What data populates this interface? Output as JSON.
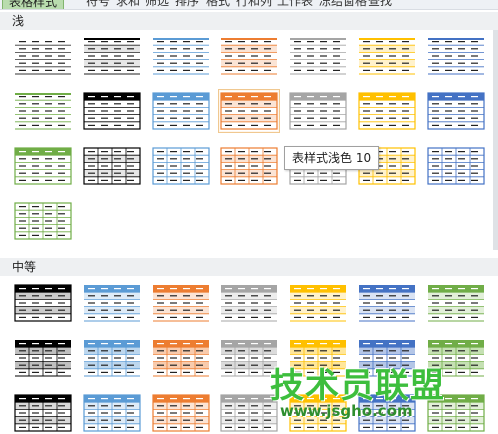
{
  "toolbar": {
    "items": [
      {
        "label": "表格样式",
        "active": true
      },
      {
        "label": "符号"
      },
      {
        "label": "求和"
      },
      {
        "label": "筛选"
      },
      {
        "label": "排序"
      },
      {
        "label": "格式"
      },
      {
        "label": "行和列"
      },
      {
        "label": "工作表"
      },
      {
        "label": "冻结窗格"
      },
      {
        "label": "查找"
      }
    ]
  },
  "sections": [
    {
      "title": "浅",
      "styles": [
        {
          "hdr": "#ffffff",
          "line": "#333333",
          "band": null,
          "border": null,
          "grid": false,
          "dark": false
        },
        {
          "hdr": "#000000",
          "line": "#222222",
          "band": "#e6e6e6",
          "border": null,
          "grid": false,
          "dark": false,
          "thinhdr": true
        },
        {
          "hdr": "#5b9bd5",
          "line": "#5b9bd5",
          "band": null,
          "border": null,
          "grid": false,
          "dark": false,
          "thinhdr": true
        },
        {
          "hdr": "#ed7d31",
          "line": "#ed7d31",
          "band": "#fbe4d5",
          "border": null,
          "grid": false,
          "dark": false,
          "thinhdr": true
        },
        {
          "hdr": "#a5a5a5",
          "line": "#a5a5a5",
          "band": null,
          "border": null,
          "grid": false,
          "dark": false,
          "thinhdr": true
        },
        {
          "hdr": "#ffc000",
          "line": "#ffc000",
          "band": "#fff2cc",
          "border": null,
          "grid": false,
          "dark": false,
          "thinhdr": true
        },
        {
          "hdr": "#4472c4",
          "line": "#4472c4",
          "band": null,
          "border": null,
          "grid": false,
          "dark": false,
          "thinhdr": true
        },
        {
          "hdr": "#70ad47",
          "line": "#70ad47",
          "band": null,
          "border": null,
          "grid": false,
          "dark": false,
          "thinhdr": true
        },
        {
          "hdr": "#000000",
          "line": "#000000",
          "band": null,
          "border": "#000000",
          "grid": false,
          "dark": true
        },
        {
          "hdr": "#5b9bd5",
          "line": "#5b9bd5",
          "band": null,
          "border": "#5b9bd5",
          "grid": false,
          "dark": true
        },
        {
          "hdr": "#ed7d31",
          "line": "#ed7d31",
          "band": "#fbe4d5",
          "border": "#ed7d31",
          "grid": false,
          "dark": true
        },
        {
          "hdr": "#a5a5a5",
          "line": "#a5a5a5",
          "band": null,
          "border": "#a5a5a5",
          "grid": false,
          "dark": true
        },
        {
          "hdr": "#ffc000",
          "line": "#ffc000",
          "band": null,
          "border": "#ffc000",
          "grid": false,
          "dark": true
        },
        {
          "hdr": "#4472c4",
          "line": "#4472c4",
          "band": null,
          "border": "#4472c4",
          "grid": false,
          "dark": true
        },
        {
          "hdr": "#70ad47",
          "line": "#70ad47",
          "band": null,
          "border": "#70ad47",
          "grid": false,
          "dark": true
        },
        {
          "hdr": "#ffffff",
          "line": "#000000",
          "band": "#e6e6e6",
          "border": "#000000",
          "grid": true,
          "dark": false
        },
        {
          "hdr": "#ffffff",
          "line": "#5b9bd5",
          "band": null,
          "border": "#5b9bd5",
          "grid": true,
          "dark": false
        },
        {
          "hdr": "#ffffff",
          "line": "#ed7d31",
          "band": "#fbe4d5",
          "border": "#ed7d31",
          "grid": true,
          "dark": false
        },
        {
          "hdr": "#ffffff",
          "line": "#a5a5a5",
          "band": null,
          "border": "#a5a5a5",
          "grid": true,
          "dark": false
        },
        {
          "hdr": "#ffffff",
          "line": "#ffc000",
          "band": "#fff2cc",
          "border": "#ffc000",
          "grid": true,
          "dark": false
        },
        {
          "hdr": "#ffffff",
          "line": "#4472c4",
          "band": null,
          "border": "#4472c4",
          "grid": true,
          "dark": false
        },
        {
          "hdr": "#ffffff",
          "line": "#70ad47",
          "band": null,
          "border": "#70ad47",
          "grid": true,
          "dark": false
        }
      ]
    },
    {
      "title": "中等",
      "styles": [
        {
          "hdr": "#000000",
          "line": "#000000",
          "band": "#cccccc",
          "border": "#000000",
          "grid": false,
          "dark": true
        },
        {
          "hdr": "#5b9bd5",
          "line": "#5b9bd5",
          "band": "#deebf7",
          "border": null,
          "grid": false,
          "dark": true
        },
        {
          "hdr": "#ed7d31",
          "line": "#ed7d31",
          "band": "#fbe4d5",
          "border": null,
          "grid": false,
          "dark": true
        },
        {
          "hdr": "#a5a5a5",
          "line": "#a5a5a5",
          "band": "#ededed",
          "border": null,
          "grid": false,
          "dark": true
        },
        {
          "hdr": "#ffc000",
          "line": "#ffc000",
          "band": "#fff2cc",
          "border": null,
          "grid": false,
          "dark": true
        },
        {
          "hdr": "#4472c4",
          "line": "#4472c4",
          "band": "#dae3f3",
          "border": null,
          "grid": false,
          "dark": true
        },
        {
          "hdr": "#70ad47",
          "line": "#70ad47",
          "band": "#e2efd9",
          "border": null,
          "grid": false,
          "dark": true
        },
        {
          "hdr": "#000000",
          "line": "#000000",
          "band": "#bfbfbf",
          "border": null,
          "grid": true,
          "dark": true
        },
        {
          "hdr": "#5b9bd5",
          "line": "#5b9bd5",
          "band": "#bdd7ee",
          "border": null,
          "grid": true,
          "dark": true
        },
        {
          "hdr": "#ed7d31",
          "line": "#ed7d31",
          "band": "#f8cbad",
          "border": null,
          "grid": true,
          "dark": true
        },
        {
          "hdr": "#a5a5a5",
          "line": "#a5a5a5",
          "band": "#dbdbdb",
          "border": null,
          "grid": true,
          "dark": true
        },
        {
          "hdr": "#ffc000",
          "line": "#ffc000",
          "band": "#ffe699",
          "border": null,
          "grid": true,
          "dark": true
        },
        {
          "hdr": "#4472c4",
          "line": "#4472c4",
          "band": "#b4c6e7",
          "border": null,
          "grid": true,
          "dark": true
        },
        {
          "hdr": "#70ad47",
          "line": "#70ad47",
          "band": "#c5e0b3",
          "border": null,
          "grid": true,
          "dark": true
        },
        {
          "hdr": "#000000",
          "line": "#000000",
          "band": "#d9d9d9",
          "border": "#000000",
          "grid": true,
          "dark": true
        },
        {
          "hdr": "#5b9bd5",
          "line": "#5b9bd5",
          "band": "#deebf7",
          "border": "#5b9bd5",
          "grid": true,
          "dark": true
        },
        {
          "hdr": "#ed7d31",
          "line": "#ed7d31",
          "band": "#fbe4d5",
          "border": "#ed7d31",
          "grid": true,
          "dark": true
        },
        {
          "hdr": "#a5a5a5",
          "line": "#a5a5a5",
          "band": "#ededed",
          "border": "#a5a5a5",
          "grid": true,
          "dark": true
        },
        {
          "hdr": "#ffc000",
          "line": "#ffc000",
          "band": "#fff2cc",
          "border": "#ffc000",
          "grid": true,
          "dark": true
        },
        {
          "hdr": "#4472c4",
          "line": "#4472c4",
          "band": "#dae3f3",
          "border": "#4472c4",
          "grid": true,
          "dark": true
        },
        {
          "hdr": "#70ad47",
          "line": "#70ad47",
          "band": "#e2efd9",
          "border": "#70ad47",
          "grid": true,
          "dark": true
        }
      ]
    }
  ],
  "hovered_style_index": 10,
  "tooltip": {
    "text": "表样式浅色 10"
  },
  "watermark": {
    "cn": "技术员联盟",
    "url": "www.jsgho.com"
  }
}
